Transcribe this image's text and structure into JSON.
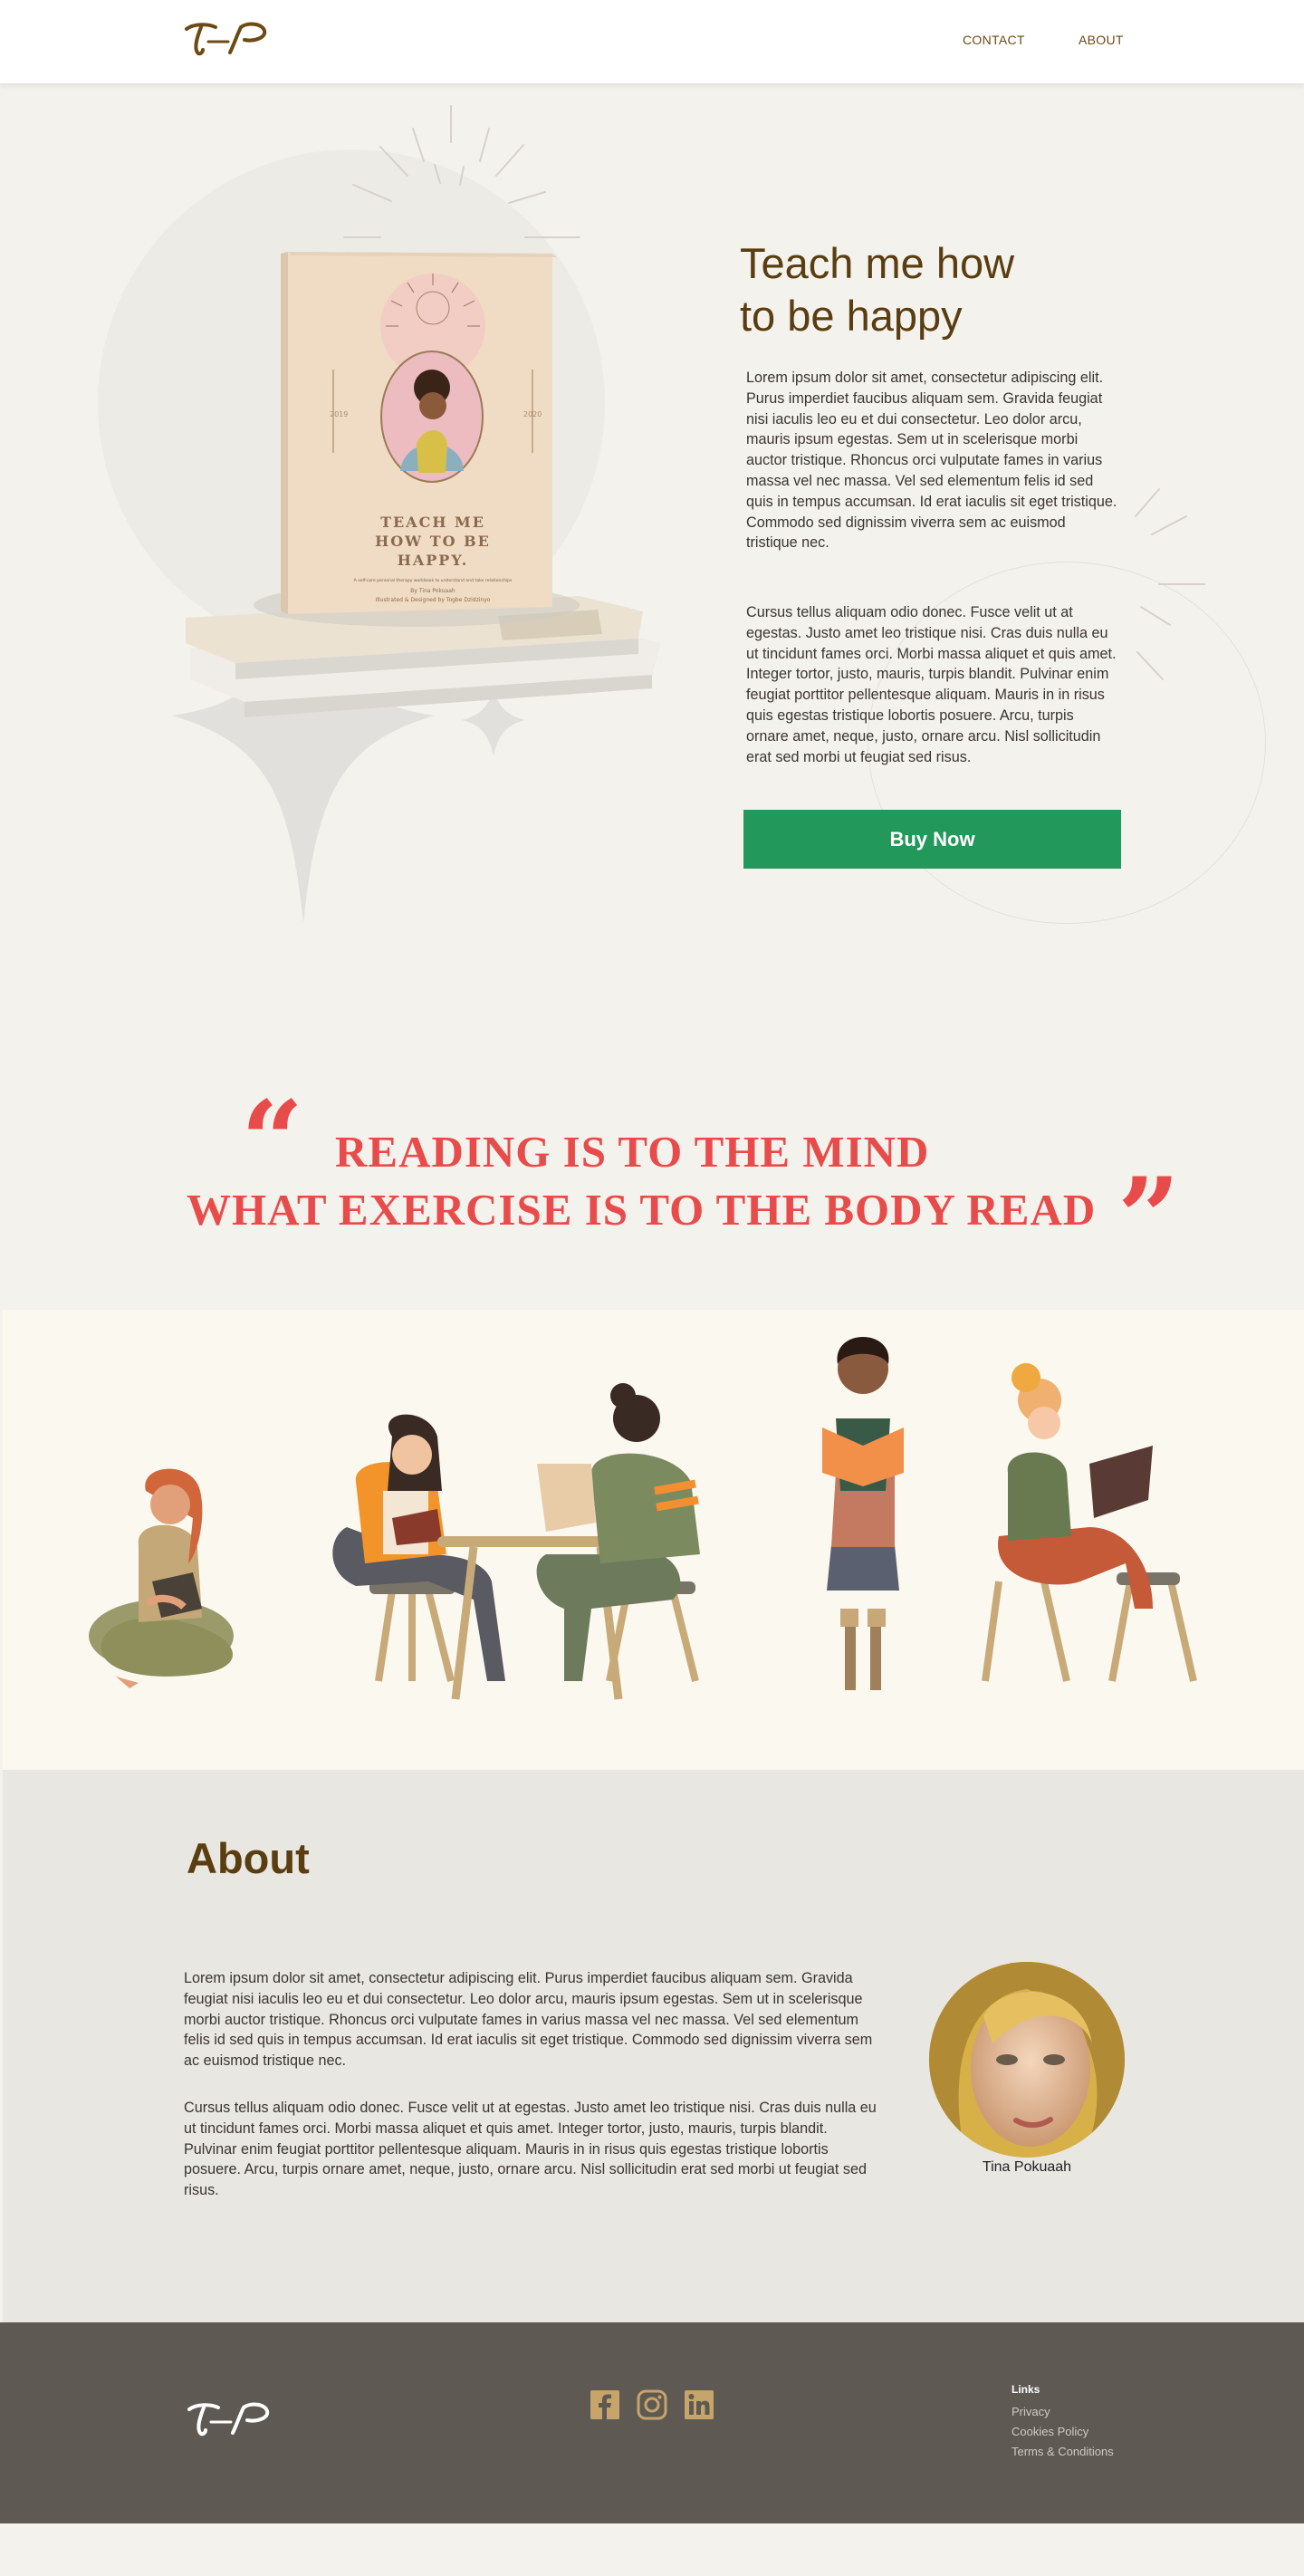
{
  "header": {
    "logo_text": "T–P",
    "nav": {
      "contact": "CONTACT",
      "about": "ABOUT"
    }
  },
  "hero": {
    "title_line1": "Teach me how",
    "title_line2": "to be happy",
    "paragraph1": "Lorem ipsum dolor sit amet, consectetur adipiscing elit. Purus imperdiet faucibus aliquam sem. Gravida feugiat nisi iaculis leo eu et dui consectetur. Leo dolor arcu, mauris ipsum egestas. Sem ut in scelerisque morbi auctor tristique. Rhoncus orci vulputate fames in varius massa vel nec massa. Vel sed elementum felis id sed quis in tempus accumsan. Id erat iaculis sit eget tristique. Commodo sed dignissim viverra sem ac euismod tristique nec.",
    "paragraph2": "Cursus tellus aliquam odio donec. Fusce velit ut at egestas. Justo amet leo tristique nisi. Cras duis nulla eu ut tincidunt fames orci. Morbi massa aliquet et quis amet. Integer tortor, justo, mauris, turpis blandit. Pulvinar enim feugiat porttitor pellentesque aliquam. Mauris in in risus quis egestas tristique lobortis posuere. Arcu, turpis ornare amet, neque, justo, ornare arcu. Nisl sollicitudin erat sed morbi ut feugiat sed risus.",
    "buy_label": "Buy Now",
    "book": {
      "cover_title_1": "TEACH ME",
      "cover_title_2": "HOW TO BE",
      "cover_title_3": "HAPPY.",
      "cover_tagline": "A self-care personal therapy workbook to understand and take relationships",
      "cover_author": "By Tina Pokuaah",
      "cover_credit": "Illustrated & Designed by Togbe Dzidzinyo",
      "side_left": "2019",
      "side_right": "2020"
    }
  },
  "quote": {
    "open_mark": "“",
    "close_mark": "”",
    "line1": "READING IS TO THE MIND",
    "line2": "WHAT EXERCISE IS TO THE BODY READ"
  },
  "about": {
    "title": "About",
    "paragraph1": "Lorem ipsum dolor sit amet, consectetur adipiscing elit. Purus imperdiet faucibus aliquam sem. Gravida feugiat nisi iaculis leo eu et dui consectetur. Leo dolor arcu, mauris ipsum egestas. Sem ut in scelerisque morbi auctor tristique. Rhoncus orci vulputate fames in varius massa vel nec massa. Vel sed elementum felis id sed quis in tempus accumsan. Id erat iaculis sit eget tristique. Commodo sed dignissim viverra sem ac euismod tristique nec.",
    "paragraph2": "Cursus tellus aliquam odio donec. Fusce velit ut at egestas. Justo amet leo tristique nisi. Cras duis nulla eu ut tincidunt fames orci. Morbi massa aliquet et quis amet. Integer tortor, justo, mauris, turpis blandit. Pulvinar enim feugiat porttitor pellentesque aliquam. Mauris in in risus quis egestas tristique lobortis posuere. Arcu, turpis ornare amet, neque, justo, ornare arcu. Nisl sollicitudin erat sed morbi ut feugiat sed risus.",
    "author_name": "Tina Pokuaah"
  },
  "footer": {
    "logo_text": "T–P",
    "social_icons": [
      "facebook-icon",
      "instagram-icon",
      "linkedin-icon"
    ],
    "links_title": "Links",
    "links": [
      "Privacy",
      "Cookies Policy",
      "Terms & Conditions"
    ]
  },
  "colors": {
    "accent_brown": "#5a3d10",
    "quote_red": "#e84c4a",
    "buy_green": "#22985a",
    "footer_bg": "#5e5a53",
    "page_bg": "#f4f2ed"
  }
}
